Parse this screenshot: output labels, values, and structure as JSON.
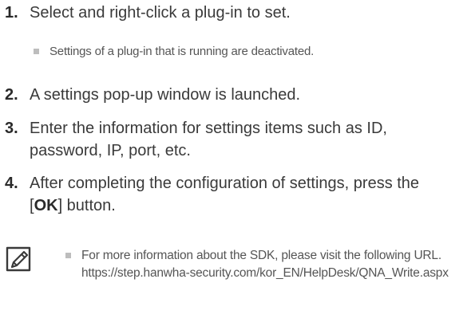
{
  "steps": [
    {
      "num": "1.",
      "text": "Select and right-click a plug-in to set."
    },
    {
      "num": "2.",
      "text": "A settings pop-up window is launched."
    },
    {
      "num": "3.",
      "text": "Enter the information for settings items such as ID, password, IP, port, etc."
    },
    {
      "num": "4.",
      "text_before": "After completing the configuration of settings, press the [",
      "text_bold": "OK",
      "text_after": "] button."
    }
  ],
  "sub_note": "Settings of a plug-in that is running are deactivated.",
  "note": {
    "icon": "note-pencil-icon",
    "text": "For more information about the SDK, please visit the following URL.",
    "url": "https://step.hanwha-security.com/kor_EN/HelpDesk/QNA_Write.aspx"
  }
}
